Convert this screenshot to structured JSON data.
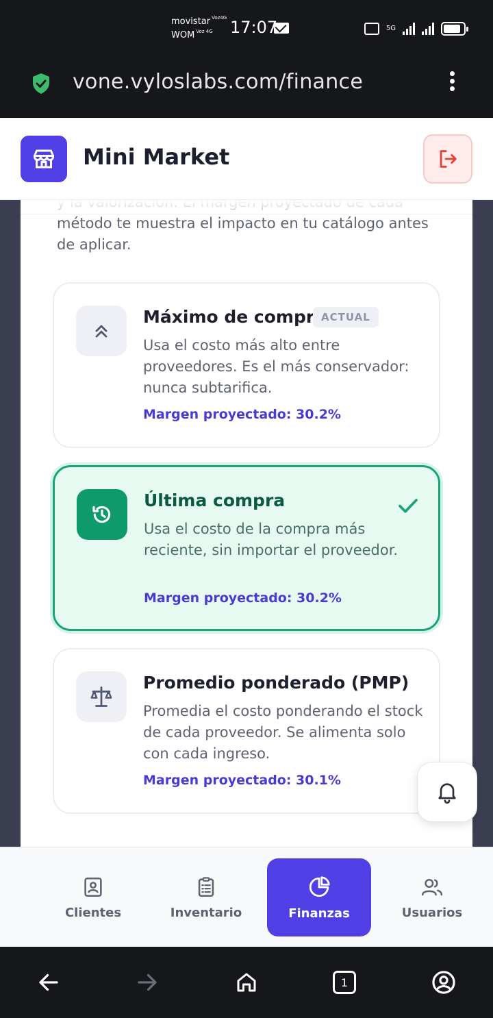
{
  "status_bar": {
    "carrier1": "movistar",
    "carrier1_tag": "Voz4G",
    "carrier2": "WOM",
    "carrier2_tag": "Voz 4G",
    "time": "17:07",
    "network": "5G"
  },
  "browser": {
    "url": "vone.vyloslabs.com/finance"
  },
  "header": {
    "app_name": "Mini Market"
  },
  "intro_text": "y la valorización. El margen proyectado de cada método te muestra el impacto en tu catálogo antes de aplicar.",
  "methods": [
    {
      "title": "Máximo de compra",
      "badge": "ACTUAL",
      "description": "Usa el costo más alto entre proveedores. Es el más conservador: nunca subtarifica.",
      "margin": "Margen proyectado: 30.2%",
      "icon": "chevrons-up-icon",
      "selected": false
    },
    {
      "title": "Última compra",
      "badge": "",
      "description": "Usa el costo de la compra más reciente, sin importar el proveedor.",
      "margin": "Margen proyectado: 30.2%",
      "icon": "history-icon",
      "selected": true
    },
    {
      "title": "Promedio ponderado (PMP)",
      "badge": "",
      "description": "Promedia el costo ponderando el stock de cada proveedor. Se alimenta solo con cada ingreso.",
      "margin": "Margen proyectado: 30.1%",
      "icon": "scale-icon",
      "selected": false
    }
  ],
  "bottom_nav": [
    {
      "label": "Clientes",
      "icon": "contact-book-icon",
      "active": false
    },
    {
      "label": "Inventario",
      "icon": "clipboard-list-icon",
      "active": false
    },
    {
      "label": "Finanzas",
      "icon": "pie-chart-icon",
      "active": true
    },
    {
      "label": "Usuarios",
      "icon": "users-icon",
      "active": false
    }
  ],
  "system_nav": {
    "tab_count": "1"
  },
  "colors": {
    "brand": "#4f3fe4",
    "selected_border": "#18a575",
    "selected_bg": "#e6faf2",
    "margin_text": "#4a3ad4",
    "logout": "#e5403a"
  }
}
